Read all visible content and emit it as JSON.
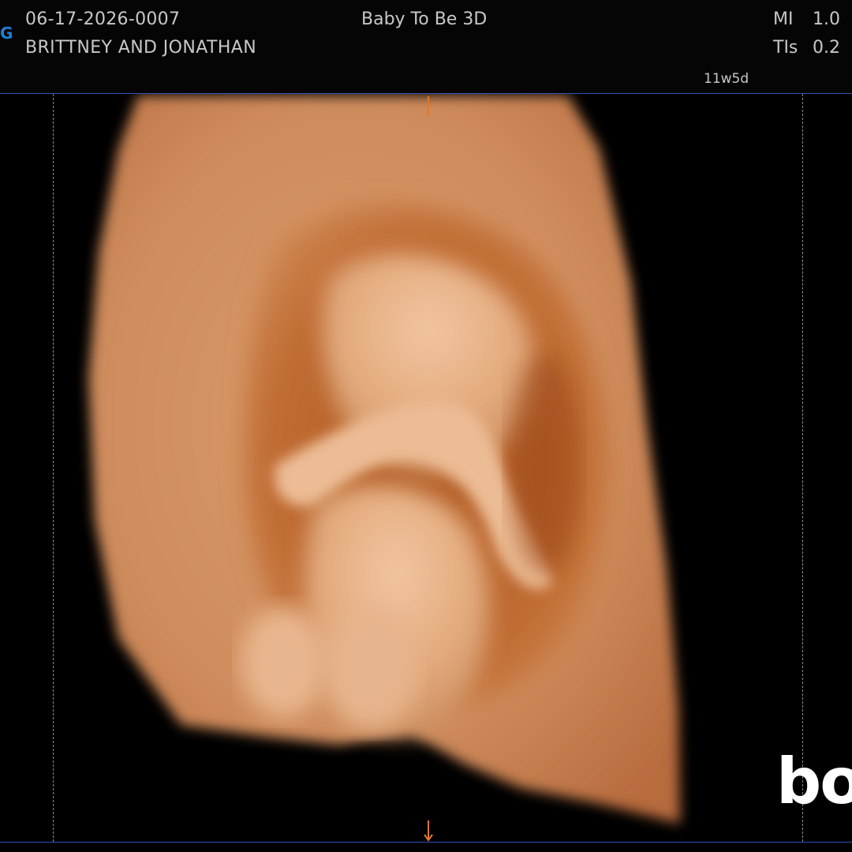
{
  "header": {
    "brand_fragment": "G",
    "exam_id": "06-17-2026-0007",
    "patient_name": "BRITTNEY AND JONATHAN",
    "preset": "Baby To Be 3D",
    "gestational_age": "11w5d",
    "mi_label": "MI",
    "mi_value": "1.0",
    "tis_label": "TIs",
    "tis_value": "0.2"
  },
  "watermark": {
    "text": "bo"
  },
  "colors": {
    "brand": "#1e7fd6",
    "marker": "#e0782c",
    "frame_line": "#2f52b8",
    "tissue_light": "#e8b48c",
    "tissue_dark": "#8a3e14"
  },
  "icons": {
    "top_marker": "orientation-tick",
    "bottom_marker": "down-arrow"
  }
}
